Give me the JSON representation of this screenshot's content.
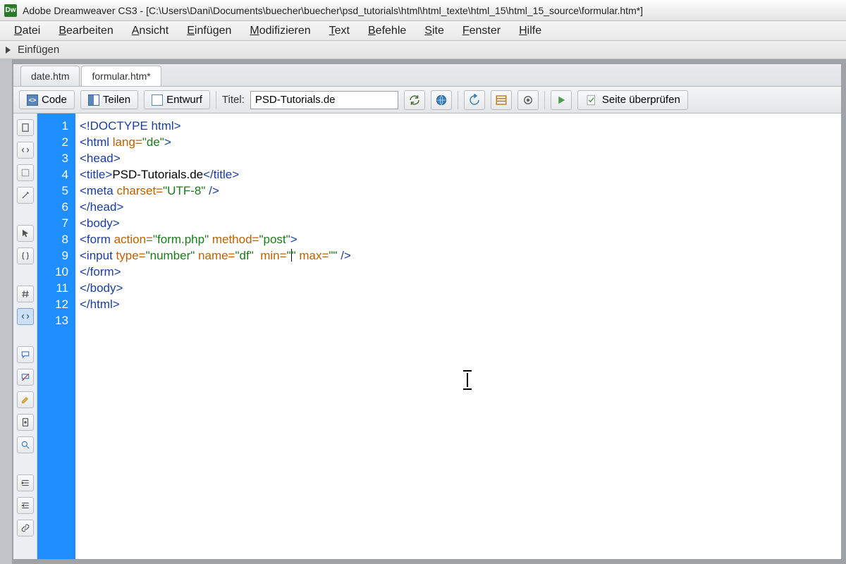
{
  "window": {
    "app_short": "Dw",
    "title": "Adobe Dreamweaver CS3 - [C:\\Users\\Dani\\Documents\\buecher\\buecher\\psd_tutorials\\html\\html_texte\\html_15\\html_15_source\\formular.htm*]"
  },
  "menu": {
    "items": [
      {
        "hot": "D",
        "rest": "atei"
      },
      {
        "hot": "B",
        "rest": "earbeiten"
      },
      {
        "hot": "A",
        "rest": "nsicht"
      },
      {
        "hot": "E",
        "rest": "infügen"
      },
      {
        "hot": "M",
        "rest": "odifizieren"
      },
      {
        "hot": "T",
        "rest": "ext"
      },
      {
        "hot": "B",
        "rest": "efehle"
      },
      {
        "hot": "S",
        "rest": "ite"
      },
      {
        "hot": "F",
        "rest": "enster"
      },
      {
        "hot": "H",
        "rest": "ilfe"
      }
    ]
  },
  "insertbar": {
    "label": "Einfügen"
  },
  "tabs": {
    "items": [
      {
        "label": "date.htm",
        "active": false
      },
      {
        "label": "formular.htm*",
        "active": true
      }
    ]
  },
  "viewbar": {
    "code": "Code",
    "split": "Teilen",
    "design": "Entwurf",
    "title_label": "Titel:",
    "title_value": "PSD-Tutorials.de",
    "check_page": "Seite überprüfen"
  },
  "editor": {
    "line_numbers": [
      "1",
      "2",
      "3",
      "4",
      "5",
      "6",
      "7",
      "8",
      "9",
      "10",
      "11",
      "12",
      "13"
    ],
    "lines": [
      {
        "segments": [
          {
            "t": "<!DOCTYPE html>",
            "c": "kw-tag"
          }
        ]
      },
      {
        "segments": [
          {
            "t": "<html ",
            "c": "kw-tag"
          },
          {
            "t": "lang=",
            "c": "kw-attr"
          },
          {
            "t": "\"de\"",
            "c": "kw-str"
          },
          {
            "t": ">",
            "c": "kw-tag"
          }
        ]
      },
      {
        "segments": [
          {
            "t": "<head>",
            "c": "kw-tag"
          }
        ]
      },
      {
        "segments": [
          {
            "t": "<title>",
            "c": "kw-tag"
          },
          {
            "t": "PSD-Tutorials.de",
            "c": ""
          },
          {
            "t": "</title>",
            "c": "kw-tag"
          }
        ]
      },
      {
        "segments": [
          {
            "t": "<meta ",
            "c": "kw-tag"
          },
          {
            "t": "charset=",
            "c": "kw-attr"
          },
          {
            "t": "\"UTF-8\"",
            "c": "kw-str"
          },
          {
            "t": " />",
            "c": "kw-tag"
          }
        ]
      },
      {
        "segments": [
          {
            "t": "</head>",
            "c": "kw-tag"
          }
        ]
      },
      {
        "segments": [
          {
            "t": "<body>",
            "c": "kw-tag"
          }
        ]
      },
      {
        "segments": [
          {
            "t": "<form ",
            "c": "kw-tag"
          },
          {
            "t": "action=",
            "c": "kw-attr"
          },
          {
            "t": "\"form.php\"",
            "c": "kw-str"
          },
          {
            "t": " ",
            "c": ""
          },
          {
            "t": "method=",
            "c": "kw-attr"
          },
          {
            "t": "\"post\"",
            "c": "kw-str"
          },
          {
            "t": ">",
            "c": "kw-tag"
          }
        ]
      },
      {
        "segments": [
          {
            "t": "<input ",
            "c": "kw-tag"
          },
          {
            "t": "type=",
            "c": "kw-attr"
          },
          {
            "t": "\"number\"",
            "c": "kw-str"
          },
          {
            "t": " ",
            "c": ""
          },
          {
            "t": "name=",
            "c": "kw-attr"
          },
          {
            "t": "\"df\"",
            "c": "kw-str"
          },
          {
            "t": "  ",
            "c": ""
          },
          {
            "t": "min=",
            "c": "kw-attr"
          },
          {
            "t": "\"",
            "c": "kw-str"
          },
          {
            "t": "",
            "c": "cursor-marker"
          },
          {
            "t": "\"",
            "c": "kw-str"
          },
          {
            "t": " ",
            "c": ""
          },
          {
            "t": "max=",
            "c": "kw-attr"
          },
          {
            "t": "\"\"",
            "c": "kw-str"
          },
          {
            "t": " />",
            "c": "kw-tag"
          }
        ]
      },
      {
        "segments": [
          {
            "t": "</form>",
            "c": "kw-tag"
          }
        ]
      },
      {
        "segments": [
          {
            "t": "</body>",
            "c": "kw-tag"
          }
        ]
      },
      {
        "segments": [
          {
            "t": "</html>",
            "c": "kw-tag"
          }
        ]
      },
      {
        "segments": []
      }
    ]
  }
}
